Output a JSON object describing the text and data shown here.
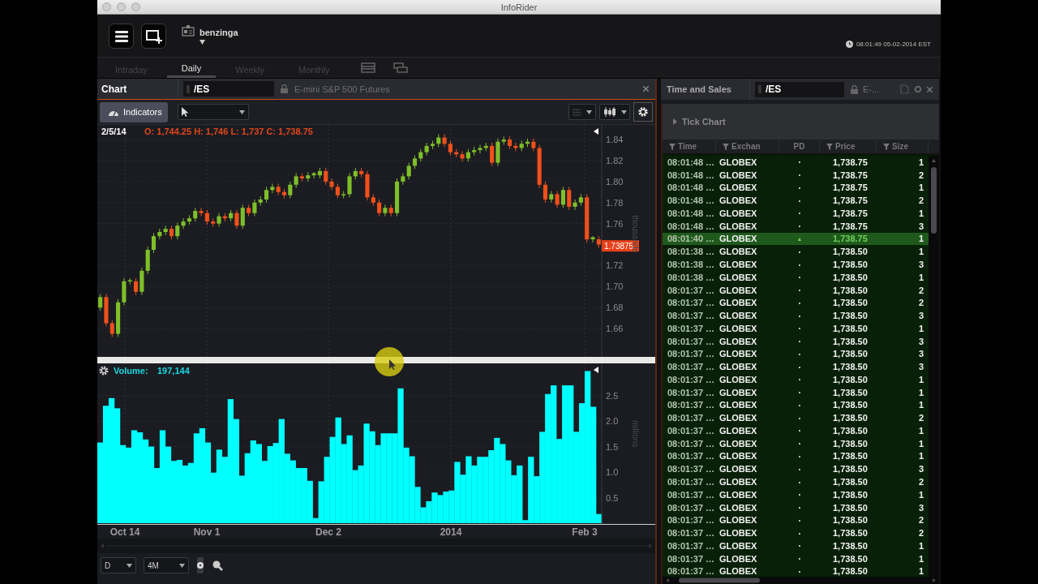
{
  "window": {
    "title": "InfoRider"
  },
  "toolbar": {
    "workspace": "benzinga",
    "clock": "08:01:49 05-02-2014 EST"
  },
  "period_tabs": [
    {
      "label": "Intraday",
      "selected": false
    },
    {
      "label": "Daily",
      "selected": true
    },
    {
      "label": "Weekly",
      "selected": false
    },
    {
      "label": "Monthly",
      "selected": false
    }
  ],
  "chart_panel": {
    "title": "Chart",
    "symbol": "/ES",
    "description": "E-mini S&P 500 Futures",
    "indicators_button": "Indicators",
    "price_chart": {
      "bar_date": "2/5/14",
      "ohlc_readout": "O: 1,744.25 H: 1,746 L: 1,737 C: 1,738.75",
      "last_price": "1.73875",
      "chart_data": {
        "type": "candlestick",
        "ylabel": "thousands",
        "ylim": [
          1.633,
          1.854
        ],
        "grid": true,
        "yticks": [
          {
            "value": 1.84,
            "label": "1.84"
          },
          {
            "value": 1.82,
            "label": "1.82"
          },
          {
            "value": 1.8,
            "label": "1.80"
          },
          {
            "value": 1.78,
            "label": "1.78"
          },
          {
            "value": 1.76,
            "label": "1.76"
          },
          {
            "value": 1.72,
            "label": "1.72"
          },
          {
            "value": 1.7,
            "label": "1.70"
          },
          {
            "value": 1.68,
            "label": "1.68"
          },
          {
            "value": 1.66,
            "label": "1.66"
          }
        ],
        "ohlc": [
          [
            1.68,
            1.693,
            1.677,
            1.69
          ],
          [
            1.69,
            1.693,
            1.662,
            1.665
          ],
          [
            1.665,
            1.668,
            1.652,
            1.655
          ],
          [
            1.655,
            1.688,
            1.652,
            1.685
          ],
          [
            1.685,
            1.708,
            1.682,
            1.705
          ],
          [
            1.705,
            1.708,
            1.702,
            1.706
          ],
          [
            1.705,
            1.708,
            1.692,
            1.695
          ],
          [
            1.695,
            1.718,
            1.692,
            1.715
          ],
          [
            1.715,
            1.738,
            1.712,
            1.735
          ],
          [
            1.735,
            1.751,
            1.732,
            1.748
          ],
          [
            1.748,
            1.755,
            1.745,
            1.752
          ],
          [
            1.752,
            1.758,
            1.749,
            1.755
          ],
          [
            1.755,
            1.758,
            1.745,
            1.748
          ],
          [
            1.748,
            1.761,
            1.745,
            1.758
          ],
          [
            1.758,
            1.765,
            1.755,
            1.762
          ],
          [
            1.762,
            1.768,
            1.759,
            1.765
          ],
          [
            1.765,
            1.775,
            1.762,
            1.772
          ],
          [
            1.772,
            1.775,
            1.767,
            1.77
          ],
          [
            1.77,
            1.773,
            1.759,
            1.762
          ],
          [
            1.762,
            1.765,
            1.757,
            1.76
          ],
          [
            1.76,
            1.77,
            1.757,
            1.767
          ],
          [
            1.767,
            1.77,
            1.762,
            1.765
          ],
          [
            1.765,
            1.773,
            1.762,
            1.77
          ],
          [
            1.77,
            1.773,
            1.755,
            1.758
          ],
          [
            1.758,
            1.778,
            1.755,
            1.775
          ],
          [
            1.775,
            1.778,
            1.767,
            1.77
          ],
          [
            1.77,
            1.783,
            1.767,
            1.78
          ],
          [
            1.78,
            1.786,
            1.777,
            1.783
          ],
          [
            1.783,
            1.795,
            1.78,
            1.792
          ],
          [
            1.792,
            1.798,
            1.789,
            1.795
          ],
          [
            1.795,
            1.798,
            1.787,
            1.79
          ],
          [
            1.79,
            1.793,
            1.784,
            1.787
          ],
          [
            1.787,
            1.8,
            1.784,
            1.797
          ],
          [
            1.797,
            1.808,
            1.794,
            1.805
          ],
          [
            1.805,
            1.808,
            1.8,
            1.803
          ],
          [
            1.803,
            1.809,
            1.8,
            1.806
          ],
          [
            1.806,
            1.809,
            1.803,
            1.808
          ],
          [
            1.806,
            1.813,
            1.803,
            1.81
          ],
          [
            1.81,
            1.813,
            1.797,
            1.8
          ],
          [
            1.8,
            1.803,
            1.792,
            1.795
          ],
          [
            1.795,
            1.798,
            1.784,
            1.787
          ],
          [
            1.787,
            1.791,
            1.784,
            1.788
          ],
          [
            1.788,
            1.808,
            1.785,
            1.805
          ],
          [
            1.805,
            1.813,
            1.802,
            1.81
          ],
          [
            1.81,
            1.813,
            1.804,
            1.807
          ],
          [
            1.807,
            1.81,
            1.782,
            1.785
          ],
          [
            1.785,
            1.788,
            1.777,
            1.78
          ],
          [
            1.78,
            1.783,
            1.767,
            1.77
          ],
          [
            1.77,
            1.778,
            1.767,
            1.775
          ],
          [
            1.775,
            1.778,
            1.767,
            1.77
          ],
          [
            1.77,
            1.803,
            1.767,
            1.8
          ],
          [
            1.8,
            1.808,
            1.797,
            1.805
          ],
          [
            1.805,
            1.818,
            1.802,
            1.815
          ],
          [
            1.815,
            1.825,
            1.812,
            1.822
          ],
          [
            1.822,
            1.831,
            1.819,
            1.828
          ],
          [
            1.828,
            1.837,
            1.825,
            1.834
          ],
          [
            1.834,
            1.839,
            1.831,
            1.836
          ],
          [
            1.836,
            1.845,
            1.833,
            1.842
          ],
          [
            1.842,
            1.845,
            1.833,
            1.836
          ],
          [
            1.836,
            1.839,
            1.825,
            1.828
          ],
          [
            1.828,
            1.831,
            1.823,
            1.826
          ],
          [
            1.826,
            1.829,
            1.819,
            1.822
          ],
          [
            1.822,
            1.831,
            1.819,
            1.828
          ],
          [
            1.828,
            1.833,
            1.825,
            1.83
          ],
          [
            1.83,
            1.835,
            1.827,
            1.832
          ],
          [
            1.832,
            1.837,
            1.829,
            1.834
          ],
          [
            1.834,
            1.837,
            1.815,
            1.818
          ],
          [
            1.818,
            1.841,
            1.815,
            1.838
          ],
          [
            1.838,
            1.843,
            1.835,
            1.84
          ],
          [
            1.84,
            1.843,
            1.831,
            1.834
          ],
          [
            1.834,
            1.837,
            1.829,
            1.832
          ],
          [
            1.832,
            1.839,
            1.829,
            1.836
          ],
          [
            1.836,
            1.841,
            1.833,
            1.838
          ],
          [
            1.838,
            1.841,
            1.829,
            1.832
          ],
          [
            1.832,
            1.835,
            1.794,
            1.797
          ],
          [
            1.797,
            1.8,
            1.78,
            1.783
          ],
          [
            1.783,
            1.791,
            1.78,
            1.788
          ],
          [
            1.788,
            1.791,
            1.775,
            1.778
          ],
          [
            1.778,
            1.795,
            1.775,
            1.792
          ],
          [
            1.792,
            1.795,
            1.773,
            1.776
          ],
          [
            1.776,
            1.783,
            1.773,
            1.78
          ],
          [
            1.78,
            1.788,
            1.777,
            1.785
          ],
          [
            1.785,
            1.788,
            1.742,
            1.745
          ],
          [
            1.745,
            1.748,
            1.742,
            1.747
          ],
          [
            1.745,
            1.748,
            1.737,
            1.74
          ]
        ]
      }
    },
    "volume": {
      "label": "Volume:",
      "value": "197,144",
      "chart_data": {
        "type": "bar",
        "ylabel": "millions",
        "ylim": [
          0,
          3.13
        ],
        "grid": true,
        "values": [
          1.58,
          2.3,
          2.45,
          2.25,
          1.53,
          1.48,
          1.82,
          1.78,
          1.64,
          1.5,
          1.08,
          1.82,
          1.5,
          1.22,
          1.24,
          1.13,
          1.18,
          1.76,
          1.86,
          1.58,
          0.99,
          1.44,
          1.3,
          2.43,
          2.04,
          0.93,
          1.37,
          1.62,
          1.55,
          1.22,
          1.51,
          1.57,
          2.04,
          1.36,
          1.23,
          1.08,
          1.08,
          0.83,
          0.1,
          0.82,
          1.3,
          1.69,
          2.07,
          1.55,
          1.72,
          1.04,
          1.13,
          1.95,
          1.8,
          1.53,
          1.76,
          1.76,
          1.76,
          2.64,
          1.48,
          1.31,
          0.71,
          0.31,
          0.43,
          0.6,
          0.55,
          0.62,
          0.64,
          1.2,
          0.95,
          1.31,
          1.13,
          1.3,
          1.3,
          1.43,
          1.67,
          1.55,
          1.23,
          0.94,
          1.13,
          0.06,
          1.3,
          0.92,
          1.79,
          2.53,
          2.7,
          1.65,
          2.7,
          2.7,
          1.79,
          2.35,
          2.98,
          2.28,
          0.18
        ],
        "yticks": [
          {
            "value": 0.5,
            "label": "0.5"
          },
          {
            "value": 1,
            "label": "1.0"
          },
          {
            "value": 1.5,
            "label": "1.5"
          },
          {
            "value": 2,
            "label": "2.0"
          },
          {
            "value": 2.5,
            "label": "2.5"
          }
        ]
      }
    },
    "date_axis": [
      "Oct 14",
      "Nov 1",
      "Dec 2",
      "2014",
      "Feb 3"
    ],
    "interval": "D",
    "range": "4M"
  },
  "time_and_sales": {
    "title": "Time and Sales",
    "symbol": "/ES",
    "description": "E-...",
    "tick_chart": {
      "label": "Tick Chart",
      "expanded": false
    },
    "columns": [
      {
        "label": "Time",
        "filter": true
      },
      {
        "label": "Exchan",
        "filter": true
      },
      {
        "label": "PD",
        "filter": false
      },
      {
        "label": "Price",
        "filter": true
      },
      {
        "label": "Size",
        "filter": true
      }
    ],
    "rows": [
      {
        "time": "08:01:48 …",
        "exchange": "GLOBEX",
        "pd": "•",
        "price": "1,738.75",
        "size": "1",
        "selected": false
      },
      {
        "time": "08:01:48 …",
        "exchange": "GLOBEX",
        "pd": "•",
        "price": "1,738.75",
        "size": "2",
        "selected": false
      },
      {
        "time": "08:01:48 …",
        "exchange": "GLOBEX",
        "pd": "•",
        "price": "1,738.75",
        "size": "1",
        "selected": false
      },
      {
        "time": "08:01:48 …",
        "exchange": "GLOBEX",
        "pd": "•",
        "price": "1,738.75",
        "size": "2",
        "selected": false
      },
      {
        "time": "08:01:48 …",
        "exchange": "GLOBEX",
        "pd": "•",
        "price": "1,738.75",
        "size": "1",
        "selected": false
      },
      {
        "time": "08:01:48 …",
        "exchange": "GLOBEX",
        "pd": "•",
        "price": "1,738.75",
        "size": "3",
        "selected": false
      },
      {
        "time": "08:01:40 …",
        "exchange": "GLOBEX",
        "pd": "▲",
        "price": "1,738.75",
        "size": "1",
        "selected": true
      },
      {
        "time": "08:01:38 …",
        "exchange": "GLOBEX",
        "pd": "•",
        "price": "1,738.50",
        "size": "1",
        "selected": false
      },
      {
        "time": "08:01:38 …",
        "exchange": "GLOBEX",
        "pd": "•",
        "price": "1,738.50",
        "size": "3",
        "selected": false
      },
      {
        "time": "08:01:38 …",
        "exchange": "GLOBEX",
        "pd": "•",
        "price": "1,738.50",
        "size": "1",
        "selected": false
      },
      {
        "time": "08:01:37 …",
        "exchange": "GLOBEX",
        "pd": "•",
        "price": "1,738.50",
        "size": "2",
        "selected": false
      },
      {
        "time": "08:01:37 …",
        "exchange": "GLOBEX",
        "pd": "•",
        "price": "1,738.50",
        "size": "2",
        "selected": false
      },
      {
        "time": "08:01:37 …",
        "exchange": "GLOBEX",
        "pd": "•",
        "price": "1,738.50",
        "size": "3",
        "selected": false
      },
      {
        "time": "08:01:37 …",
        "exchange": "GLOBEX",
        "pd": "•",
        "price": "1,738.50",
        "size": "1",
        "selected": false
      },
      {
        "time": "08:01:37 …",
        "exchange": "GLOBEX",
        "pd": "•",
        "price": "1,738.50",
        "size": "3",
        "selected": false
      },
      {
        "time": "08:01:37 …",
        "exchange": "GLOBEX",
        "pd": "•",
        "price": "1,738.50",
        "size": "3",
        "selected": false
      },
      {
        "time": "08:01:37 …",
        "exchange": "GLOBEX",
        "pd": "•",
        "price": "1,738.50",
        "size": "3",
        "selected": false
      },
      {
        "time": "08:01:37 …",
        "exchange": "GLOBEX",
        "pd": "•",
        "price": "1,738.50",
        "size": "1",
        "selected": false
      },
      {
        "time": "08:01:37 …",
        "exchange": "GLOBEX",
        "pd": "•",
        "price": "1,738.50",
        "size": "1",
        "selected": false
      },
      {
        "time": "08:01:37 …",
        "exchange": "GLOBEX",
        "pd": "•",
        "price": "1,738.50",
        "size": "1",
        "selected": false
      },
      {
        "time": "08:01:37 …",
        "exchange": "GLOBEX",
        "pd": "•",
        "price": "1,738.50",
        "size": "2",
        "selected": false
      },
      {
        "time": "08:01:37 …",
        "exchange": "GLOBEX",
        "pd": "•",
        "price": "1,738.50",
        "size": "1",
        "selected": false
      },
      {
        "time": "08:01:37 …",
        "exchange": "GLOBEX",
        "pd": "•",
        "price": "1,738.50",
        "size": "1",
        "selected": false
      },
      {
        "time": "08:01:37 …",
        "exchange": "GLOBEX",
        "pd": "•",
        "price": "1,738.50",
        "size": "1",
        "selected": false
      },
      {
        "time": "08:01:37 …",
        "exchange": "GLOBEX",
        "pd": "•",
        "price": "1,738.50",
        "size": "3",
        "selected": false
      },
      {
        "time": "08:01:37 …",
        "exchange": "GLOBEX",
        "pd": "•",
        "price": "1,738.50",
        "size": "2",
        "selected": false
      },
      {
        "time": "08:01:37 …",
        "exchange": "GLOBEX",
        "pd": "•",
        "price": "1,738.50",
        "size": "1",
        "selected": false
      },
      {
        "time": "08:01:37 …",
        "exchange": "GLOBEX",
        "pd": "•",
        "price": "1,738.50",
        "size": "3",
        "selected": false
      },
      {
        "time": "08:01:37 …",
        "exchange": "GLOBEX",
        "pd": "•",
        "price": "1,738.50",
        "size": "2",
        "selected": false
      },
      {
        "time": "08:01:37 …",
        "exchange": "GLOBEX",
        "pd": "•",
        "price": "1,738.50",
        "size": "2",
        "selected": false
      },
      {
        "time": "08:01:37 …",
        "exchange": "GLOBEX",
        "pd": "•",
        "price": "1,738.50",
        "size": "1",
        "selected": false
      },
      {
        "time": "08:01:37 …",
        "exchange": "GLOBEX",
        "pd": "•",
        "price": "1,738.50",
        "size": "1",
        "selected": false
      },
      {
        "time": "08:01:37 …",
        "exchange": "GLOBEX",
        "pd": "•",
        "price": "1,738.50",
        "size": "1",
        "selected": false
      }
    ]
  }
}
